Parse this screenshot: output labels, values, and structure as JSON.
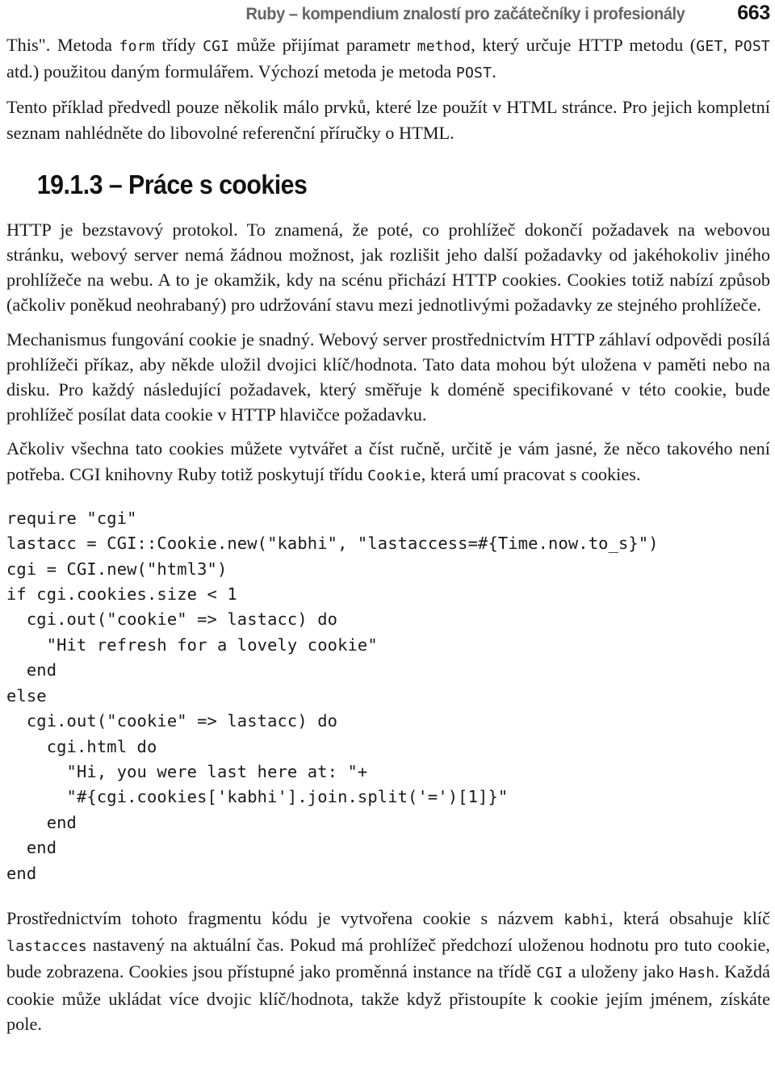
{
  "running_head": {
    "title": "Ruby – kompendium znalostí pro začátečníky i profesionály",
    "page_number": "663"
  },
  "colors": {
    "running_head_title": "#646464",
    "page_number": "#151515",
    "body_text": "#1a1a1a",
    "heading": "#111111",
    "page_background": "#ffffff"
  },
  "content": {
    "paragraph_1": {
      "part_1": "This\". Metoda ",
      "code_1": "form",
      "part_2": " třídy ",
      "code_2": "CGI",
      "part_3": " může přijímat parametr ",
      "code_3": "method",
      "part_4": ", který určuje HTTP metodu (",
      "code_4": "GET",
      "part_5": ", ",
      "code_5": "POST",
      "part_6": " atd.) použitou daným formulářem. Výchozí metoda je metoda ",
      "code_6": "POST",
      "part_7": "."
    },
    "paragraph_2": "Tento příklad předvedl pouze několik málo prvků, které lze použít v HTML stránce. Pro jejich kompletní seznam nahlédněte do libovolné referenční příručky o HTML.",
    "heading": "19.1.3 – Práce s cookies",
    "paragraph_3": "HTTP je bezstavový protokol. To znamená, že poté, co prohlížeč dokončí požadavek na webovou stránku, webový server nemá žádnou možnost, jak rozlišit jeho další požadavky od jakéhokoliv jiného prohlížeče na webu. A to je okamžik, kdy na scénu přichází HTTP cookies. Cookies totiž nabízí způsob (ačkoliv poněkud neohrabaný) pro udržování stavu mezi jednotlivými požadavky ze stejného prohlížeče.",
    "paragraph_4": "Mechanismus fungování cookie je snadný. Webový server prostřednictvím HTTP záhlaví odpovědi posílá prohlížeči příkaz, aby někde uložil dvojici klíč/hodnota. Tato data mohou být uložena v paměti nebo na disku. Pro každý následující požadavek, který směřuje k doméně specifikované v této cookie, bude prohlížeč posílat data cookie v HTTP hlavičce požadavku.",
    "paragraph_5": {
      "part_1": "Ačkoliv všechna tato cookies můžete vytvářet a číst ručně, určitě je vám jasné, že něco takového není potřeba. CGI knihovny Ruby totiž poskytují třídu ",
      "code_1": "Cookie",
      "part_2": ", která umí pracovat s cookies."
    },
    "code_listing": "require \"cgi\"\nlastacc = CGI::Cookie.new(\"kabhi\", \"lastaccess=#{Time.now.to_s}\")\ncgi = CGI.new(\"html3\")\nif cgi.cookies.size < 1\n  cgi.out(\"cookie\" => lastacc) do\n    \"Hit refresh for a lovely cookie\"\n  end\nelse\n  cgi.out(\"cookie\" => lastacc) do\n    cgi.html do\n      \"Hi, you were last here at: \"+\n      \"#{cgi.cookies['kabhi'].join.split('=')[1]}\"\n    end\n  end\nend",
    "paragraph_6": {
      "part_1": "Prostřednictvím tohoto fragmentu kódu je vytvořena cookie s názvem ",
      "code_1": "kabhi",
      "part_2": ", která obsahuje klíč ",
      "code_2": "lastacces",
      "part_3": " nastavený na aktuální čas. Pokud má prohlížeč předchozí uloženou hodnotu pro tuto cookie, bude zobrazena. Cookies jsou přístupné jako proměnná instance na třídě ",
      "code_3": "CGI",
      "part_4": " a uloženy jako ",
      "code_4": "Hash",
      "part_5": ". Každá cookie může ukládat více dvojic klíč/hodnota, takže když přistoupíte k cookie jejím jménem, získáte pole."
    }
  }
}
